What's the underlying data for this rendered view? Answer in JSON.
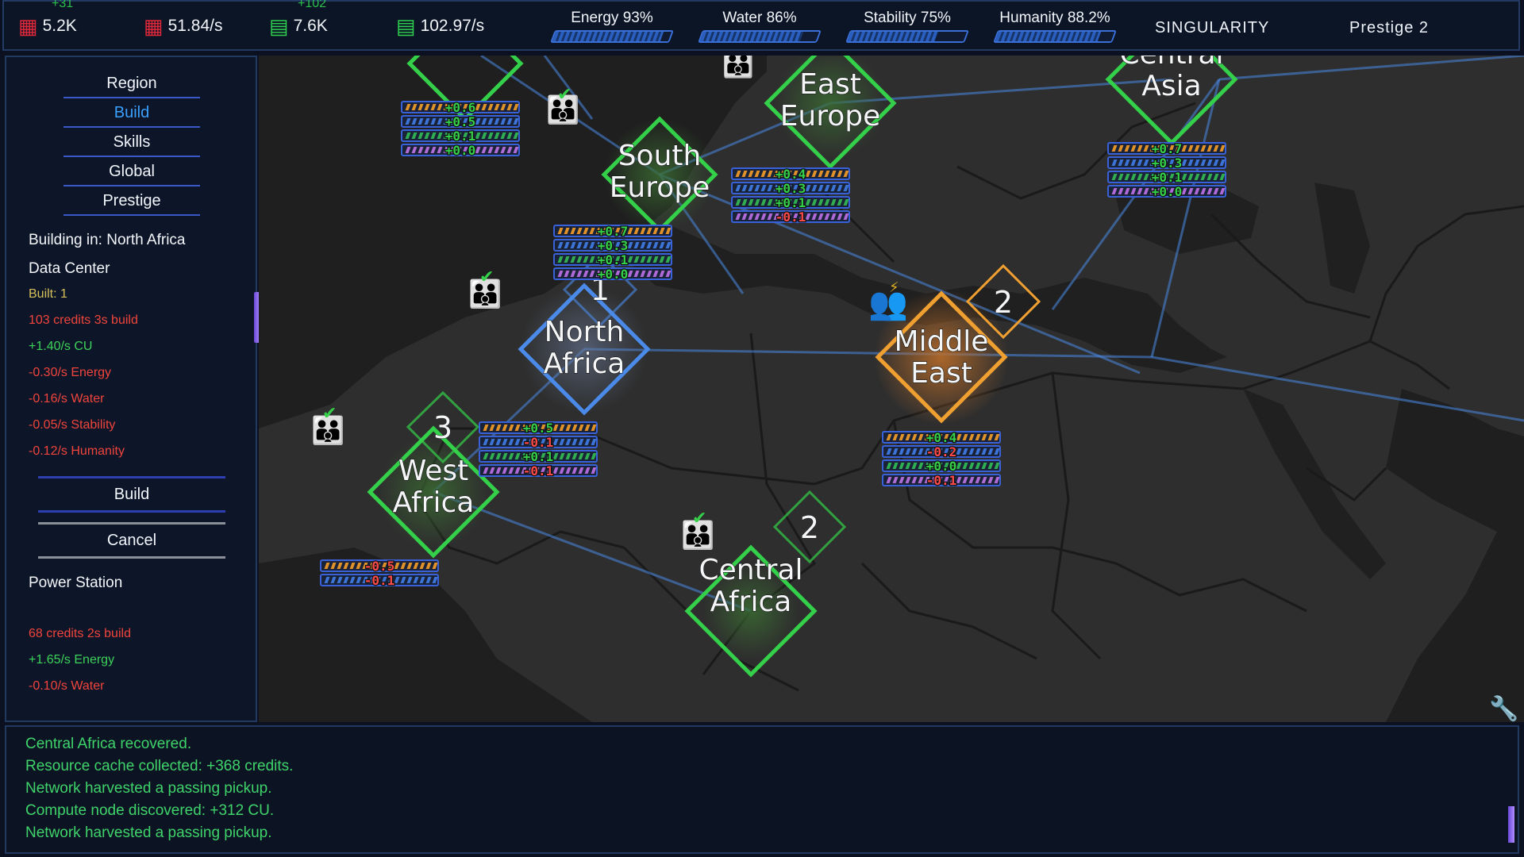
{
  "topbar": {
    "resources": [
      {
        "id": "cu",
        "icon": "chip-icon",
        "value": "5.2K",
        "ghost": "+31"
      },
      {
        "id": "cu_rate",
        "icon": "chip-plus-icon",
        "value": "51.84/s"
      },
      {
        "id": "credits",
        "icon": "cash-icon",
        "value": "7.6K",
        "ghost": "+102"
      },
      {
        "id": "credit_rate",
        "icon": "cash-plus-icon",
        "value": "102.97/s"
      }
    ],
    "meters": [
      {
        "label": "Energy 93%",
        "level": 0.93
      },
      {
        "label": "Water 86%",
        "level": 0.86
      },
      {
        "label": "Stability 75%",
        "level": 0.75
      },
      {
        "label": "Humanity 88.2%",
        "level": 0.882
      }
    ],
    "mode": "SINGULARITY",
    "prestige": "Prestige 2"
  },
  "left_panel": {
    "nav": [
      "Region",
      "Build",
      "Skills",
      "Global",
      "Prestige"
    ],
    "active_nav": "Build",
    "building_in": "Building in: North Africa",
    "selected": {
      "name": "Data Center",
      "built": "Built: 1",
      "cost": "103 credits  3s build",
      "stats": [
        "+1.40/s CU",
        "-0.30/s Energy",
        "-0.16/s Water",
        "-0.05/s Stability",
        "-0.12/s Humanity"
      ]
    },
    "build_button": "Build",
    "cancel_button": "Cancel",
    "next": {
      "name": "Power Station",
      "cost": "68 credits  2s build",
      "stats": [
        "+1.65/s Energy",
        "-0.10/s Water"
      ]
    }
  },
  "regions": [
    {
      "name": [
        "South",
        "Europe"
      ],
      "stats": [
        "+0.6",
        "+0.5",
        "+0.1",
        "+0.0"
      ]
    },
    {
      "name": [
        "East",
        "Europe"
      ],
      "stats": [
        "+0.4",
        "+0.3",
        "+0.1",
        "-0.1"
      ]
    },
    {
      "name": [
        "Central",
        "Asia"
      ],
      "stats": [
        "+0.7",
        "+0.3",
        "+0.1",
        "+0.0"
      ]
    },
    {
      "name": [
        "North",
        "Africa"
      ],
      "stats": [
        "+0.5",
        "-0.1",
        "+0.1",
        "-0.1"
      ]
    },
    {
      "name": [
        "Middle",
        "East"
      ],
      "stats": [
        "+0.4",
        "-0.2",
        "+0.0",
        "-0.1"
      ]
    },
    {
      "name": [
        "West",
        "Africa"
      ],
      "stats": [
        "-0.5",
        "-0.1"
      ]
    },
    {
      "name": [
        "Central",
        "Africa"
      ],
      "stats": []
    }
  ],
  "italy_stats": [
    "+0.7",
    "+0.3",
    "+0.1",
    "+0.0"
  ],
  "region_numbers": [
    "1",
    "2",
    "3",
    "2"
  ],
  "status_colors": {
    "controlled": "#35d04a",
    "unstable": "#f0a030",
    "selected": "#4a8ae8",
    "neg": "#ff4a4a"
  },
  "log": [
    "Central Africa recovered.",
    "Resource cache collected: +368 credits.",
    "Network harvested a passing pickup.",
    "Compute node discovered: +312 CU.",
    "Network harvested a passing pickup."
  ]
}
